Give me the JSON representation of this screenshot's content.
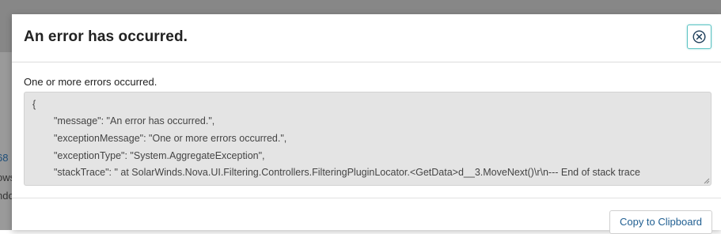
{
  "background": {
    "line1": "68",
    "line2": "ows",
    "line3": "ndo"
  },
  "modal": {
    "title": "An error has occurred.",
    "close_icon": "close-circle-icon",
    "summary": "One or more errors occurred.",
    "details": {
      "line1": "{",
      "line2": "\"message\": \"An error has occurred.\",",
      "line3": "\"exceptionMessage\": \"One or more errors occurred.\",",
      "line4": "\"exceptionType\": \"System.AggregateException\",",
      "line5": "\"stackTrace\": \"   at SolarWinds.Nova.UI.Filtering.Controllers.FilteringPluginLocator.<GetData>d__3.MoveNext()\\r\\n--- End of stack trace"
    },
    "copy_label": "Copy to Clipboard"
  },
  "colors": {
    "accent": "#5fc4c4",
    "link": "#1f5e91"
  }
}
